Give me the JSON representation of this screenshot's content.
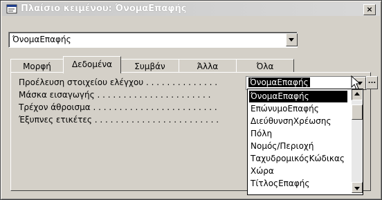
{
  "window": {
    "title": "Πλαίσιο κειμένου: ΌνομαΕπαφής",
    "close_label": "×"
  },
  "object_selector": {
    "value": "ΌνομαΕπαφής"
  },
  "tabs": [
    {
      "label": "Μορφή",
      "active": false
    },
    {
      "label": "Δεδομένα",
      "active": true
    },
    {
      "label": "Συμβάν",
      "active": false
    },
    {
      "label": "Άλλα",
      "active": false
    },
    {
      "label": "Όλα",
      "active": false
    }
  ],
  "properties": [
    {
      "label": "Προέλευση στοιχείου ελέγχου . . . . . . . . . . . . . ."
    },
    {
      "label": "Μάσκα εισαγωγής . . . . . . . . . . . . . . . . . . . . . ."
    },
    {
      "label": "Τρέχον άθροισμα . . . . . . . . . . . . . . . . . . . . . . . ."
    },
    {
      "label": "Έξυπνες ετικέτες . . . . . . . . . . . . . . . . . . . . . . . ."
    }
  ],
  "control_source": {
    "value": "ΌνομαΕπαφής",
    "build_label": "..."
  },
  "dropdown_list": [
    "ΌνομαΕπαφής",
    "ΕπώνυμοΕπαφής",
    "ΔιεύθυνσηΧρέωσης",
    "Πόλη",
    "Νομός/Περιοχή",
    "ΤαχυδρομικόςΚώδικας",
    "Χώρα",
    "ΤίτλοςΕπαφής"
  ]
}
